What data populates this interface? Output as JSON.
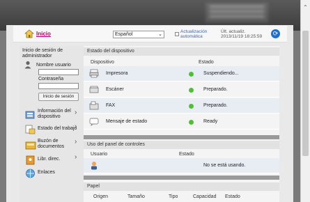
{
  "header": {
    "home_label": "Inicio",
    "language": "Español",
    "auto_update": "Actualización automática",
    "auto_update_line1": "Actualización",
    "auto_update_line2": "automática",
    "last_update_line1": "Últ. actualiz.",
    "last_update_line2": "2013/11/19 18:25:59"
  },
  "login": {
    "title": "Inicio de sesión de administrador",
    "username_label": "Nombre usuario",
    "password_label": "Contraseña",
    "login_button": "Inicio de sesión"
  },
  "sidebar": {
    "items": [
      {
        "label_line1": "Información del",
        "label_line2": "dispositivo",
        "icon": "device-info-icon"
      },
      {
        "label_line1": "Estado del trabajo",
        "label_line2": "",
        "icon": "job-status-icon"
      },
      {
        "label_line1": "Buzón de",
        "label_line2": "documentos",
        "icon": "document-box-icon"
      },
      {
        "label_line1": "Libr. direc.",
        "label_line2": "",
        "icon": "address-book-icon"
      },
      {
        "label_line1": "Enlaces",
        "label_line2": "",
        "icon": "links-icon"
      }
    ]
  },
  "device_status": {
    "title": "Estado del dispositivo",
    "col_device": "Dispositivo",
    "col_status": "Estado",
    "rows": [
      {
        "name": "Impresora",
        "status": "Suspendiendo...",
        "icon": "printer-icon"
      },
      {
        "name": "Escáner",
        "status": "Preparado.",
        "icon": "scanner-icon"
      },
      {
        "name": "FAX",
        "status": "Preparado.",
        "icon": "fax-icon"
      },
      {
        "name": "Mensaje de estado",
        "status": "Ready",
        "icon": "status-message-icon"
      }
    ],
    "status_color": "#4cc22f"
  },
  "panel_usage": {
    "title": "Uso del panel de controles",
    "col_user": "Usuario",
    "col_status": "Estado",
    "row_status": "No se está usando."
  },
  "paper": {
    "title": "Papel",
    "cols": [
      "Origen",
      "Tamaño",
      "Tipo",
      "Capacidad",
      "Estado"
    ]
  },
  "colors": {
    "accent": "#b5006a",
    "refresh": "#1e6fd0"
  }
}
